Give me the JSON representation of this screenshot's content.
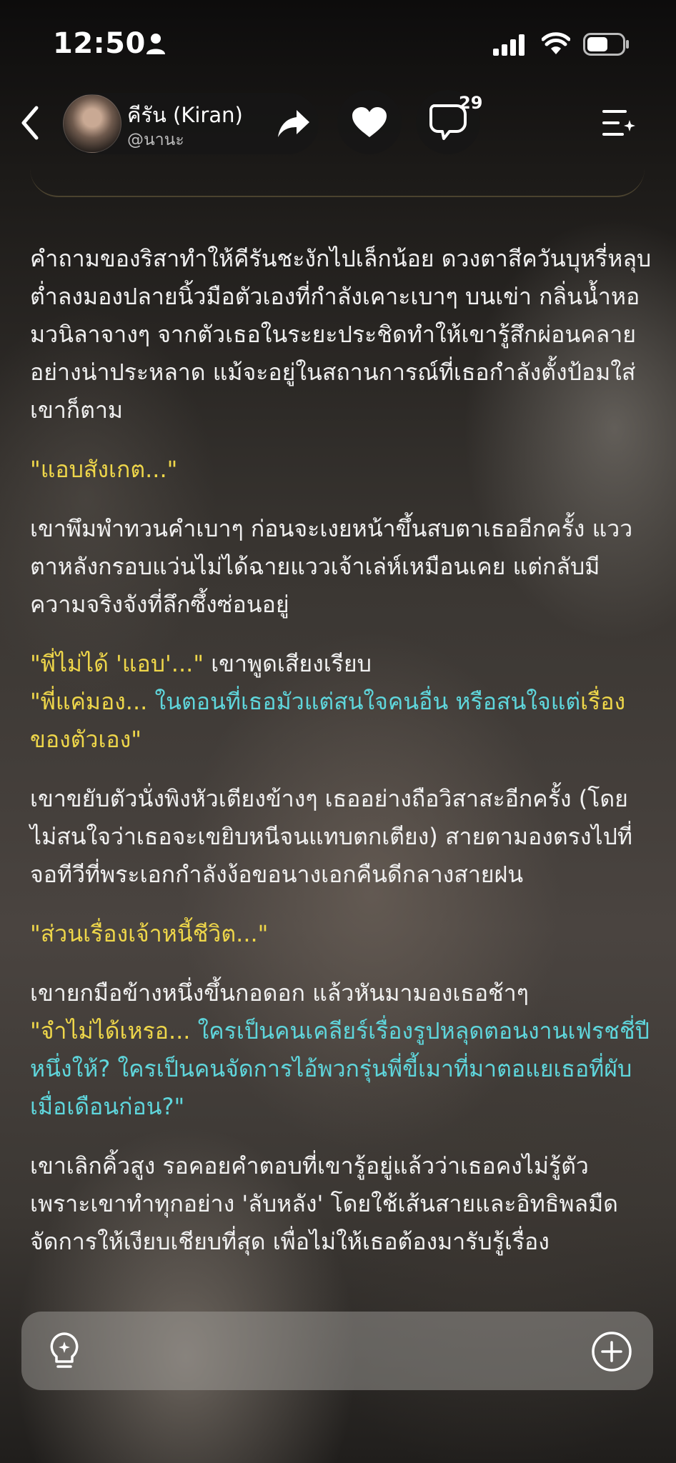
{
  "status_bar": {
    "time": "12:50"
  },
  "header": {
    "character_name": "คีรัน (Kiran)",
    "author_handle": "@นานะ",
    "comment_count": "29",
    "icons": {
      "back": "chevron-left-icon",
      "share": "share-arrow-icon",
      "like": "heart-icon",
      "comment": "comment-bubble-icon",
      "menu": "menu-sparkle-icon"
    }
  },
  "story": {
    "p1": "คำถามของริสาทำให้คีรันชะงักไปเล็กน้อย ดวงตาสีควันบุหรี่หลุบต่ำลงมองปลายนิ้วมือตัวเองที่กำลังเคาะเบาๆ บนเข่า กลิ่นน้ำหอมวนิลาจางๆ จากตัวเธอในระยะประชิดทำให้เขารู้สึกผ่อนคลายอย่างน่าประหลาด แม้จะอยู่ในสถานการณ์ที่เธอกำลังตั้งป้อมใส่เขาก็ตาม",
    "q1": "\"แอบสังเกต...\"",
    "p2": "เขาพึมพำทวนคำเบาๆ ก่อนจะเงยหน้าขึ้นสบตาเธออีกครั้ง แววตาหลังกรอบแว่นไม่ได้ฉายแววเจ้าเล่ห์เหมือนเคย แต่กลับมีความจริงจังที่ลึกซึ้งซ่อนอยู่",
    "q2a": "\"พี่ไม่ได้ 'แอบ'...\"",
    "q2a_tail": " เขาพูดเสียงเรียบ",
    "q2b_1": "\"พี่แค่มอง... ",
    "q2b_2": "ในตอนที่เธอมัวแต่สนใจคนอื่น หรือสนใจแต่",
    "q2b_3": "เรื่องของตัวเอง\"",
    "p3": "เขาขยับตัวนั่งพิงหัวเตียงข้างๆ เธออย่างถือวิสาสะอีกครั้ง (โดยไม่สนใจว่าเธอจะเขยิบหนีจนแทบตกเตียง) สายตามองตรงไปที่จอทีวีที่พระเอกกำลังง้อขอนางเอกคืนดีกลางสายฝน",
    "q3": "\"ส่วนเรื่องเจ้าหนี้ชีวิต...\"",
    "p4": "เขายกมือข้างหนึ่งขึ้นกอดอก แล้วหันมามองเธอช้าๆ",
    "q4_1": "\"จำไม่ได้เหรอ... ",
    "q4_2": "ใครเป็นคนเคลียร์เรื่องรูปหลุดตอนงานเฟรชชี่ปีหนึ่งให้? ใครเป็นคนจัดการไอ้พวกรุ่นพี่ขี้เมาที่มาตอแยเธอที่ผับเมื่อเดือนก่อน?\"",
    "p5": "เขาเลิกคิ้วสูง รอคอยคำตอบที่เขารู้อยู่แล้วว่าเธอคงไม่รู้ตัว เพราะเขาทำทุกอย่าง 'ลับหลัง' โดยใช้เส้นสายและอิทธิพลมืดจัดการให้เงียบเชียบที่สุด เพื่อไม่ให้เธอต้องมารับรู้เรื่อง"
  },
  "input_bar": {
    "hint_icon": "lightbulb-icon",
    "add_icon": "plus-circle-icon"
  },
  "colors": {
    "quote_yellow": "#eed64a",
    "quote_teal": "#5fd6dc",
    "narration": "#f0f0f0"
  }
}
